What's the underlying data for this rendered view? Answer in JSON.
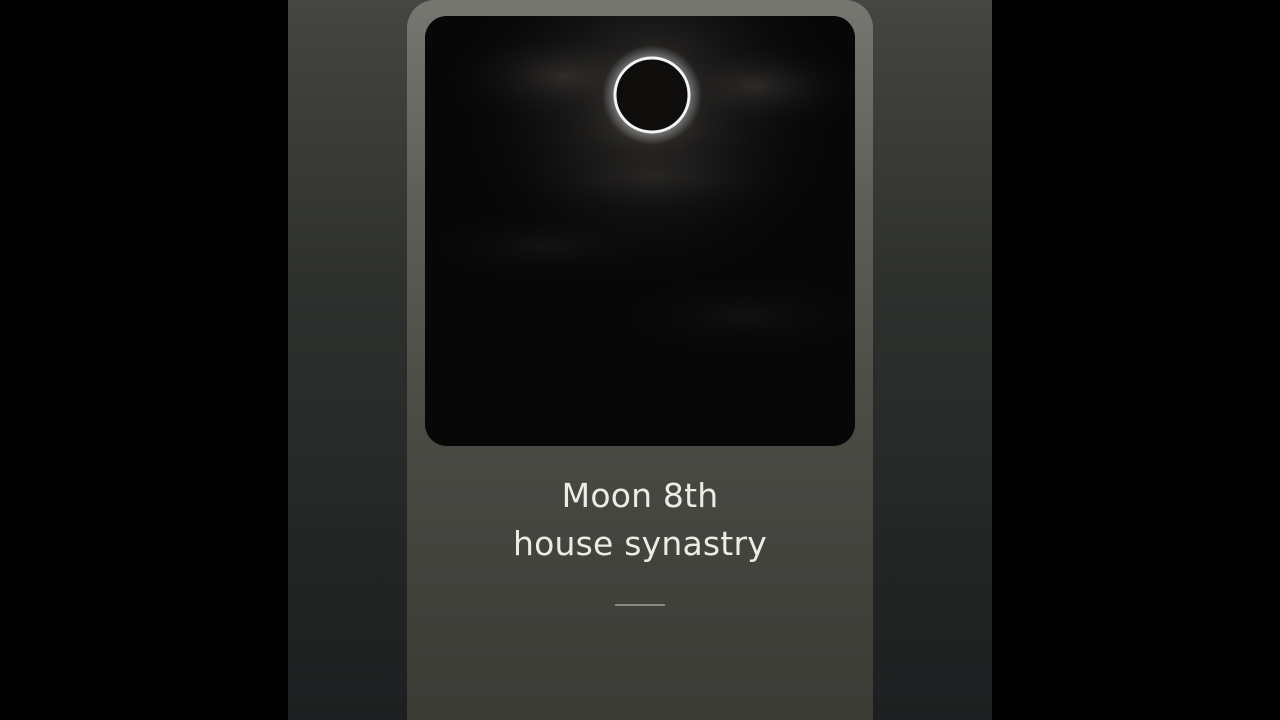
{
  "card": {
    "title_line1": "Moon 8th",
    "title_line2": "house synastry"
  },
  "photo": {
    "subject": "annular eclipse ring in cloudy night sky",
    "ring_color": "#f4f4f4"
  },
  "colors": {
    "letterbox": "#000000",
    "card_top": "#777771",
    "card_bottom": "#3b3b36",
    "title_text": "#ecebe4"
  }
}
